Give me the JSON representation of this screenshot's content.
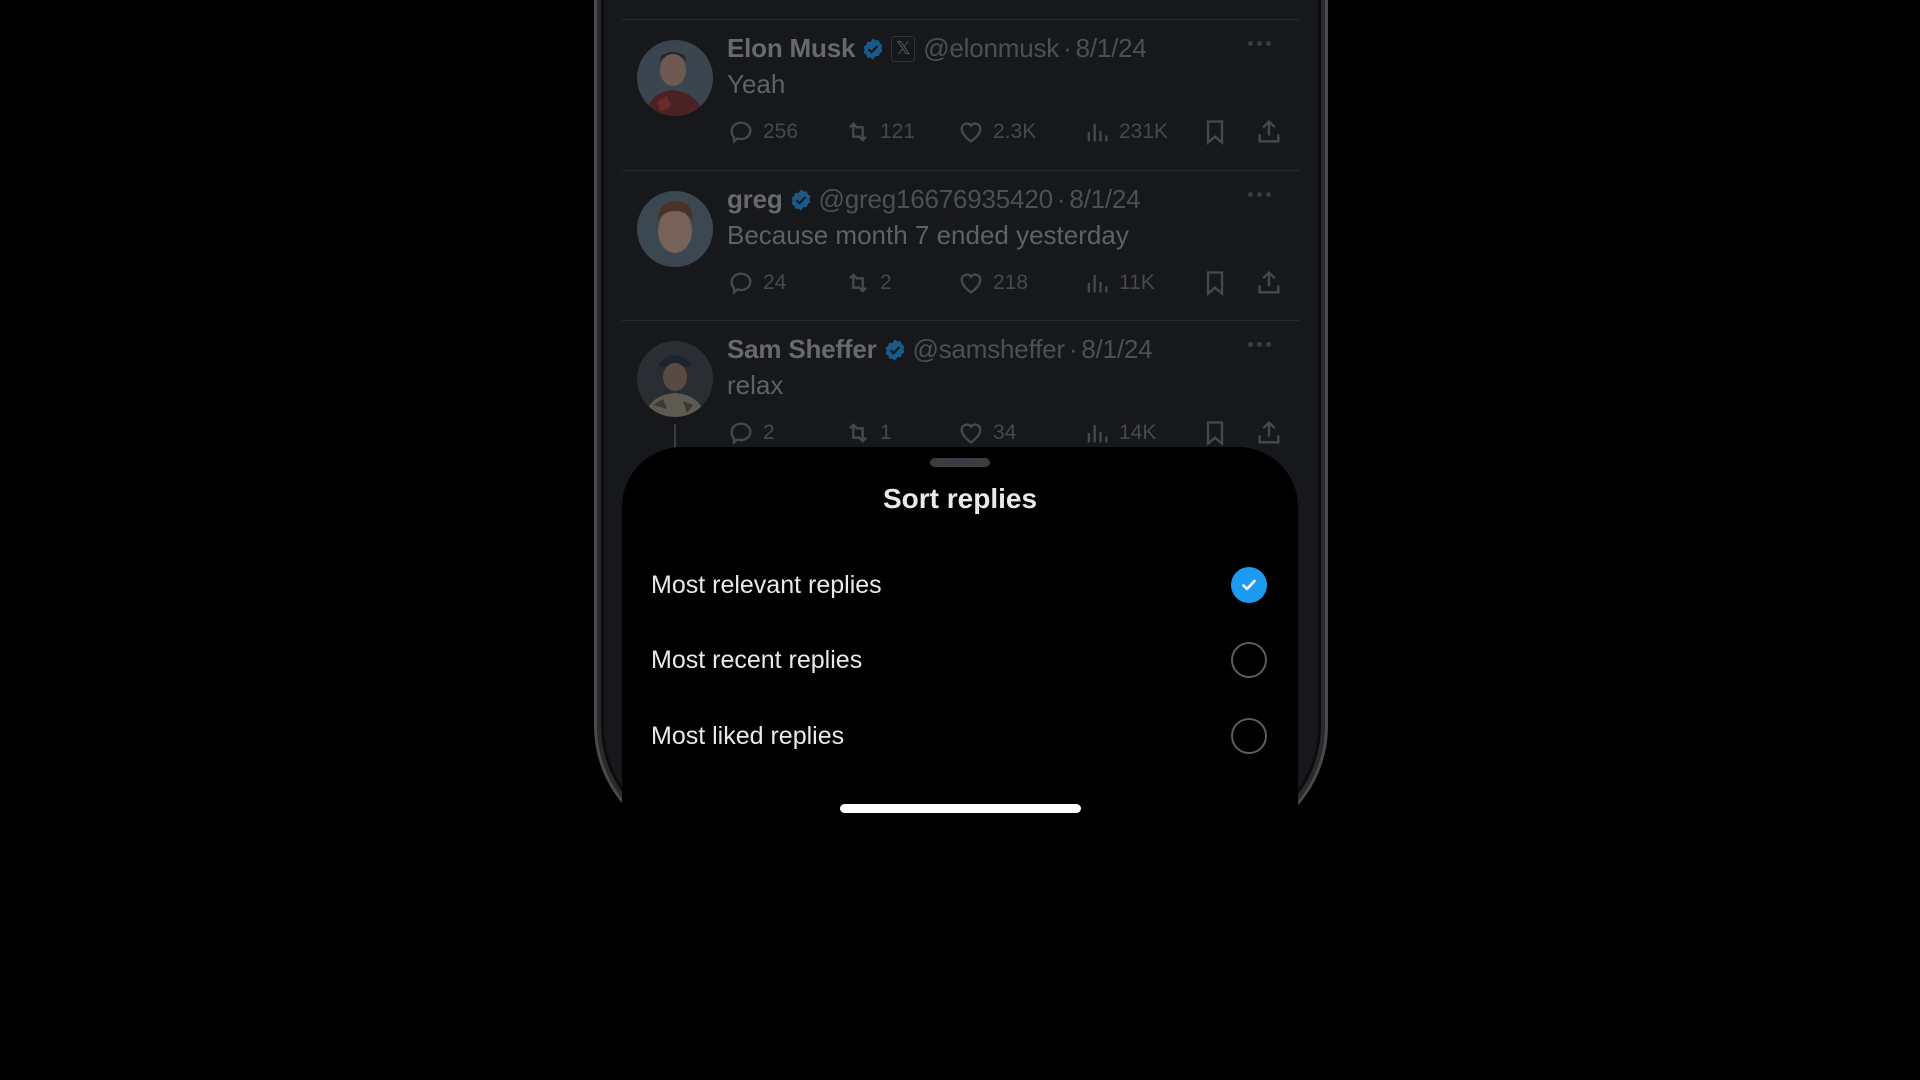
{
  "feed": {
    "tweets": [
      {
        "name": "Elon Musk",
        "verified": true,
        "affiliate_badge": "𝕏",
        "handle": "@elonmusk",
        "separator": "·",
        "date": "8/1/24",
        "text": "Yeah",
        "replies": "256",
        "retweets": "121",
        "likes": "2.3K",
        "views": "231K"
      },
      {
        "name": "greg",
        "verified": true,
        "handle": "@greg16676935420",
        "separator": "·",
        "date": "8/1/24",
        "text": "Because month 7 ended yesterday",
        "replies": "24",
        "retweets": "2",
        "likes": "218",
        "views": "11K"
      },
      {
        "name": "Sam Sheffer",
        "verified": true,
        "handle": "@samsheffer",
        "separator": "·",
        "date": "8/1/24",
        "text": "relax",
        "replies": "2",
        "retweets": "1",
        "likes": "34",
        "views": "14K"
      }
    ]
  },
  "sort_sheet": {
    "title": "Sort replies",
    "options": [
      {
        "label": "Most relevant replies",
        "selected": true
      },
      {
        "label": "Most recent replies",
        "selected": false
      },
      {
        "label": "Most liked replies",
        "selected": false
      }
    ]
  },
  "colors": {
    "accent": "#1d9bf0",
    "sheet_background": "#000000",
    "feed_background_dimmed": "#17181b"
  }
}
